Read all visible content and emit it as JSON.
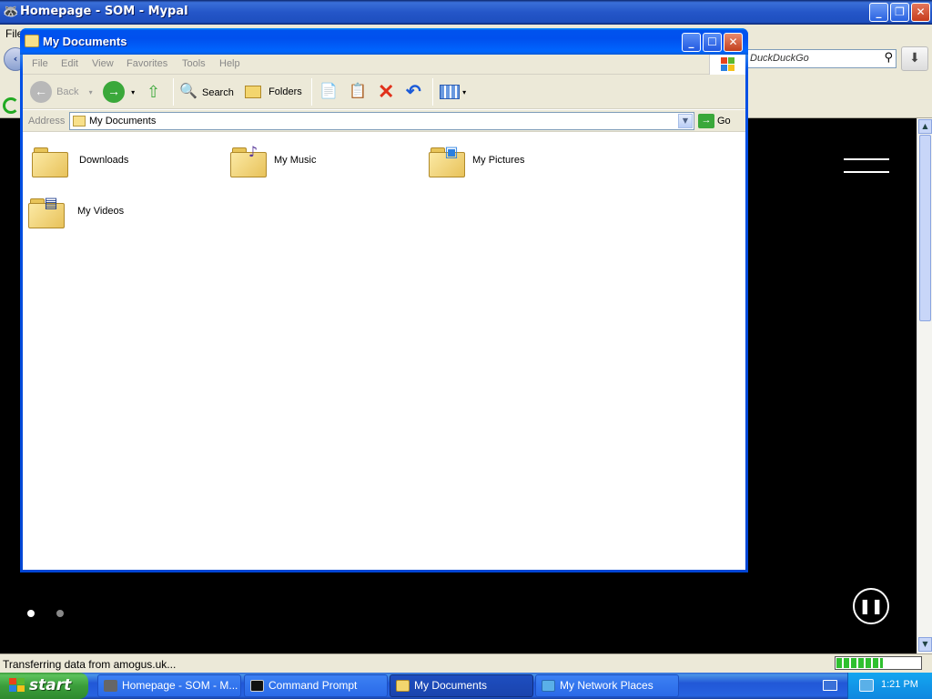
{
  "browser": {
    "title": "Homepage - SOM - Mypal",
    "menu_first": "File",
    "search_placeholder": "DuckDuckGo",
    "status_text": "Transferring data from amogus.uk...",
    "progress": 0.55
  },
  "explorer": {
    "title": "My Documents",
    "menu": [
      "File",
      "Edit",
      "View",
      "Favorites",
      "Tools",
      "Help"
    ],
    "toolbar": {
      "back": "Back",
      "search": "Search",
      "folders": "Folders"
    },
    "address_label": "Address",
    "address_value": "My Documents",
    "go_label": "Go",
    "files": [
      {
        "name": "Downloads",
        "icon": "folder-icon"
      },
      {
        "name": "My Music",
        "icon": "music-folder-icon"
      },
      {
        "name": "My Pictures",
        "icon": "pictures-folder-icon"
      },
      {
        "name": "My Videos",
        "icon": "videos-folder-icon"
      }
    ]
  },
  "taskbar": {
    "start": "start",
    "tasks": [
      {
        "label": "Homepage - SOM - M...",
        "icon": "mypal-icon",
        "active": false
      },
      {
        "label": "Command Prompt",
        "icon": "cmd-icon",
        "active": false
      },
      {
        "label": "My Documents",
        "icon": "folder-icon",
        "active": true
      },
      {
        "label": "My Network Places",
        "icon": "network-icon",
        "active": false
      }
    ],
    "clock": "1:21 PM"
  },
  "colors": {
    "xp_blue": "#0054E3",
    "start_green": "#3C9A3C",
    "folder_yellow": "#F5D76E"
  }
}
